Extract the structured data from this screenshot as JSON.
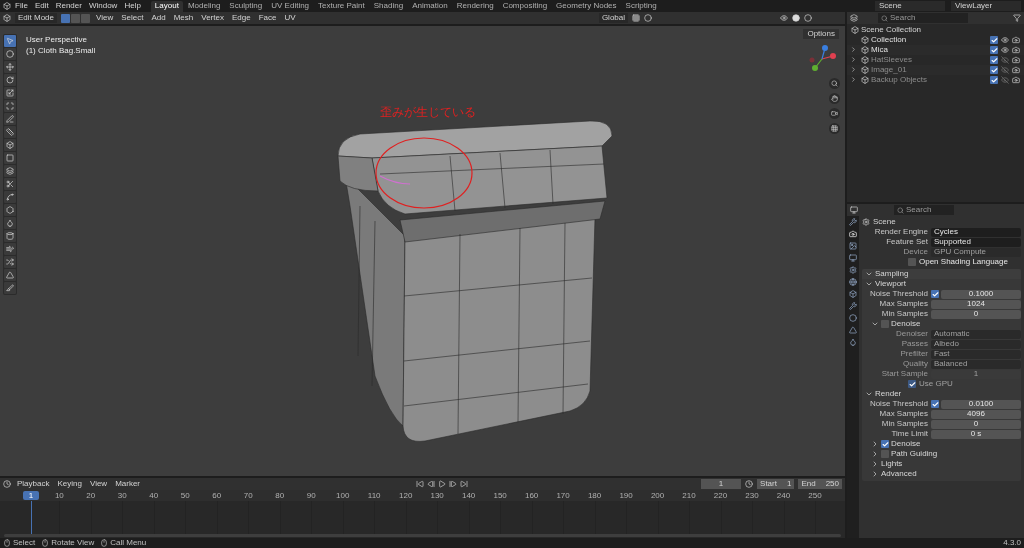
{
  "topbar": {
    "menus": [
      "File",
      "Edit",
      "Render",
      "Window",
      "Help"
    ],
    "workspaces": [
      {
        "label": "Layout",
        "selected": true
      },
      {
        "label": "Modeling",
        "selected": false
      },
      {
        "label": "Sculpting",
        "selected": false
      },
      {
        "label": "UV Editing",
        "selected": false
      },
      {
        "label": "Texture Paint",
        "selected": false
      },
      {
        "label": "Shading",
        "selected": false
      },
      {
        "label": "Animation",
        "selected": false
      },
      {
        "label": "Rendering",
        "selected": false
      },
      {
        "label": "Compositing",
        "selected": false
      },
      {
        "label": "Geometry Nodes",
        "selected": false
      },
      {
        "label": "Scripting",
        "selected": false
      }
    ],
    "scene": "Scene",
    "view_layer": "ViewLayer"
  },
  "viewport": {
    "mode": "Edit Mode",
    "select_modes": [
      {
        "selected": true
      },
      {
        "selected": false
      },
      {
        "selected": false
      }
    ],
    "menus": [
      "View",
      "Select",
      "Add",
      "Mesh",
      "Vertex",
      "Edge",
      "Face",
      "UV"
    ],
    "orientation": "Global",
    "options": "Options",
    "view_name": "User Perspective",
    "object_name": "(1) Cloth Bag.Small",
    "annotation": "歪みが生じている",
    "tools": [
      {
        "selected": true
      },
      {
        "selected": false
      },
      {
        "selected": false
      },
      {
        "selected": false
      },
      {
        "selected": false
      },
      {
        "selected": false
      },
      {
        "selected": false
      },
      {
        "selected": false
      },
      {
        "selected": false
      },
      {
        "selected": false
      },
      {
        "selected": false
      },
      {
        "selected": false
      },
      {
        "selected": false
      },
      {
        "selected": false
      },
      {
        "selected": false
      },
      {
        "selected": false
      },
      {
        "selected": false
      },
      {
        "selected": false
      },
      {
        "selected": false
      },
      {
        "selected": false
      }
    ]
  },
  "outliner": {
    "search_placeholder": "Search",
    "root": "Scene Collection",
    "items": [
      {
        "name": "Collection",
        "hidden": false,
        "expandable": false,
        "enabled": true
      },
      {
        "name": "Mica",
        "hidden": false,
        "expandable": true,
        "enabled": true
      },
      {
        "name": "HatSleeves",
        "hidden": true,
        "expandable": true,
        "enabled": true
      },
      {
        "name": "Image_01",
        "hidden": true,
        "expandable": true,
        "enabled": true
      },
      {
        "name": "Backup Objects",
        "hidden": true,
        "expandable": true,
        "enabled": true
      }
    ]
  },
  "properties": {
    "search_placeholder": "Search",
    "context": "Scene",
    "fields": [
      {
        "kind": "dropdown",
        "label": "Render Engine",
        "value": "Cycles",
        "disabled": false
      },
      {
        "kind": "dropdown",
        "label": "Feature Set",
        "value": "Supported",
        "disabled": false
      },
      {
        "kind": "dropdown",
        "label": "Device",
        "value": "GPU Compute",
        "disabled": true
      },
      {
        "kind": "checkbox",
        "label": "Open Shading Language",
        "checked": false,
        "disabled": false
      }
    ],
    "panel": {
      "title": "Sampling",
      "expanded": true,
      "subpanels": [
        {
          "title": "Viewport",
          "expanded": true,
          "rows": [
            {
              "kind": "toggle_number",
              "label": "Noise Threshold",
              "checked": true,
              "value": "0.1000",
              "disabled": false
            },
            {
              "kind": "number",
              "label": "Max Samples",
              "value": "1024",
              "disabled": false
            },
            {
              "kind": "number",
              "label": "Min Samples",
              "value": "0",
              "disabled": false
            }
          ],
          "children": [
            {
              "title": "Denoise",
              "expanded": true,
              "checked": false,
              "rows": [
                {
                  "kind": "dropdown",
                  "label": "Denoiser",
                  "value": "Automatic",
                  "disabled": true
                },
                {
                  "kind": "dropdown",
                  "label": "Passes",
                  "value": "Albedo",
                  "disabled": true
                },
                {
                  "kind": "dropdown",
                  "label": "Prefilter",
                  "value": "Fast",
                  "disabled": true
                },
                {
                  "kind": "dropdown",
                  "label": "Quality",
                  "value": "Balanced",
                  "disabled": true
                },
                {
                  "kind": "number",
                  "label": "Start Sample",
                  "value": "1",
                  "disabled": true
                },
                {
                  "kind": "checkbox",
                  "label": "Use GPU",
                  "checked": true,
                  "disabled": true
                }
              ]
            }
          ]
        },
        {
          "title": "Render",
          "expanded": true,
          "rows": [
            {
              "kind": "toggle_number",
              "label": "Noise Threshold",
              "checked": true,
              "value": "0.0100",
              "disabled": false
            },
            {
              "kind": "number",
              "label": "Max Samples",
              "value": "4096",
              "disabled": false
            },
            {
              "kind": "number",
              "label": "Min Samples",
              "value": "0",
              "disabled": false
            },
            {
              "kind": "number",
              "label": "Time Limit",
              "value": "0 s",
              "disabled": false
            }
          ],
          "children": [
            {
              "title": "Denoise",
              "expanded": false,
              "checked": true
            },
            {
              "title": "Path Guiding",
              "expanded": false,
              "checked": false
            },
            {
              "title": "Lights",
              "expanded": false
            },
            {
              "title": "Advanced",
              "expanded": false
            }
          ]
        }
      ]
    }
  },
  "timeline": {
    "menus": [
      "Playback",
      "Keying",
      "View",
      "Marker"
    ],
    "current_frame": "1",
    "start_label": "Start",
    "start": "1",
    "end_label": "End",
    "end": "250",
    "ruler": [
      {
        "label": "1",
        "selected": true
      },
      {
        "label": "10",
        "selected": false
      },
      {
        "label": "20",
        "selected": false
      },
      {
        "label": "30",
        "selected": false
      },
      {
        "label": "40",
        "selected": false
      },
      {
        "label": "50",
        "selected": false
      },
      {
        "label": "60",
        "selected": false
      },
      {
        "label": "70",
        "selected": false
      },
      {
        "label": "80",
        "selected": false
      },
      {
        "label": "90",
        "selected": false
      },
      {
        "label": "100",
        "selected": false
      },
      {
        "label": "110",
        "selected": false
      },
      {
        "label": "120",
        "selected": false
      },
      {
        "label": "130",
        "selected": false
      },
      {
        "label": "140",
        "selected": false
      },
      {
        "label": "150",
        "selected": false
      },
      {
        "label": "160",
        "selected": false
      },
      {
        "label": "170",
        "selected": false
      },
      {
        "label": "180",
        "selected": false
      },
      {
        "label": "190",
        "selected": false
      },
      {
        "label": "200",
        "selected": false
      },
      {
        "label": "210",
        "selected": false
      },
      {
        "label": "220",
        "selected": false
      },
      {
        "label": "230",
        "selected": false
      },
      {
        "label": "240",
        "selected": false
      },
      {
        "label": "250",
        "selected": false
      }
    ]
  },
  "status_bar": {
    "hints": [
      "Select",
      "Rotate View",
      "Call Menu"
    ],
    "version": "4.3.0"
  }
}
